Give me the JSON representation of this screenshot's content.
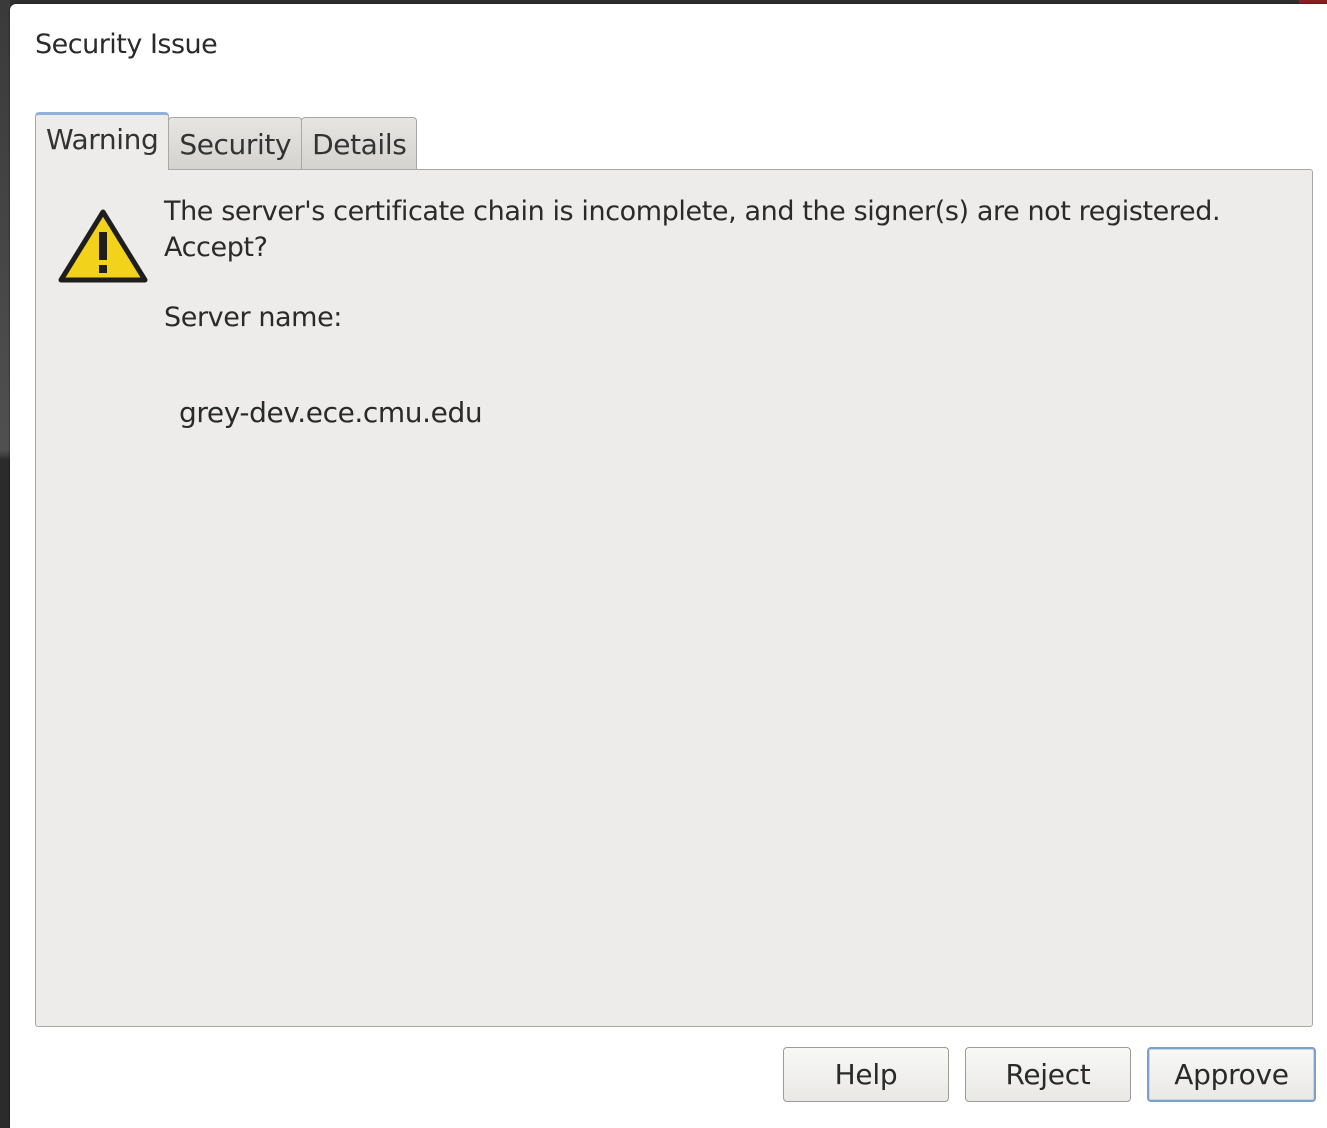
{
  "window": {
    "title": "Security Issue"
  },
  "tabs": [
    {
      "label": "Warning",
      "active": true
    },
    {
      "label": "Security",
      "active": false
    },
    {
      "label": "Details",
      "active": false
    }
  ],
  "warning_tab": {
    "icon": "warning-icon",
    "message": "The server's certificate chain is incomplete, and the signer(s) are not registered. Accept?",
    "server_name_label": "Server name:",
    "server_name_value": "grey-dev.ece.cmu.edu"
  },
  "buttons": {
    "help_label": "Help",
    "reject_label": "Reject",
    "approve_label": "Approve"
  },
  "colors": {
    "warning_yellow": "#f2d21b",
    "active_tab_accent": "#8fb1d8",
    "panel_background": "#edecea"
  }
}
